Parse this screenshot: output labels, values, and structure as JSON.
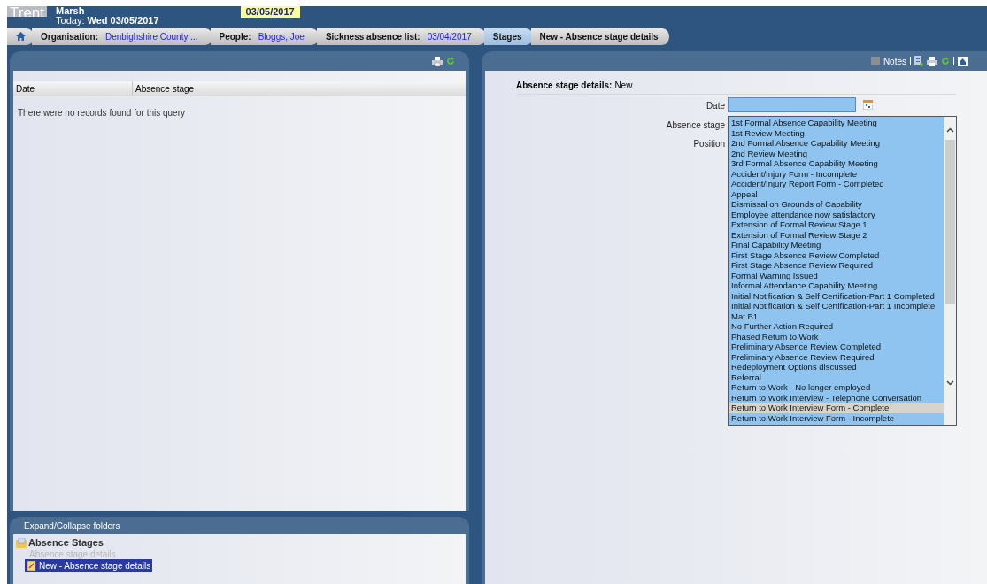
{
  "header": {
    "logo": "Trent",
    "user": "Marsh",
    "today_label": "Today:",
    "today_value": "Wed 03/05/2017",
    "date_badge": "03/05/2017"
  },
  "breadcrumbs": [
    {
      "kind": "home"
    },
    {
      "kind": "pair",
      "label": "Organisation:",
      "value": "Denbighshire County ..."
    },
    {
      "kind": "pair",
      "label": "People:",
      "value": "Bloggs, Joe"
    },
    {
      "kind": "pair",
      "label": "Sickness absence list:",
      "value": "03/04/2017"
    },
    {
      "kind": "plain",
      "label": "Stages",
      "selected": true
    },
    {
      "kind": "plain",
      "label": "New - Absence stage details",
      "selected": false
    }
  ],
  "left_panel": {
    "table": {
      "columns": [
        "Date",
        "Absence stage"
      ],
      "empty_message": "There were no records found for this query"
    }
  },
  "folders": {
    "title": "Expand/Collapse folders",
    "tree": [
      {
        "label": "Absence Stages",
        "children": [
          {
            "label": "Absence stage details",
            "disabled": true,
            "selected": false
          },
          {
            "label": "New - Absence stage details",
            "disabled": false,
            "selected": true
          }
        ]
      }
    ]
  },
  "right_panel": {
    "toolbar": {
      "notes": "Notes"
    },
    "heading_label": "Absence stage details:",
    "heading_value": "New",
    "form": {
      "date_label": "Date",
      "stage_label": "Absence stage",
      "position_label": "Position",
      "options": [
        {
          "label": "1st Formal Absence Capability Meeting",
          "selected": false
        },
        {
          "label": "1st Review Meeting",
          "selected": false
        },
        {
          "label": "2nd Formal Absence Capability Meeting",
          "selected": false
        },
        {
          "label": "2nd Review Meeting",
          "selected": false
        },
        {
          "label": "3rd Formal Absence Capability Meeting",
          "selected": false
        },
        {
          "label": "Accident/Injury Form - Incomplete",
          "selected": false
        },
        {
          "label": "Accident/Injury Report Form - Completed",
          "selected": false
        },
        {
          "label": "Appeal",
          "selected": false
        },
        {
          "label": "Dismissal on Grounds of Capability",
          "selected": false
        },
        {
          "label": "Employee attendance now satisfactory",
          "selected": false
        },
        {
          "label": "Extension of Formal Review Stage 1",
          "selected": false
        },
        {
          "label": "Extension of Formal Review Stage 2",
          "selected": false
        },
        {
          "label": "Final Capability Meeting",
          "selected": false
        },
        {
          "label": "First Stage Absence Review Completed",
          "selected": false
        },
        {
          "label": "First Stage Absence Review Required",
          "selected": false
        },
        {
          "label": "Formal Warning Issued",
          "selected": false
        },
        {
          "label": "Informal Attendance Capability Meeting",
          "selected": false
        },
        {
          "label": "Initial Notification & Self Certification-Part 1 Completed",
          "selected": false
        },
        {
          "label": "Initial Notification & Self Certification-Part 1 Incomplete",
          "selected": false
        },
        {
          "label": "Mat B1",
          "selected": false
        },
        {
          "label": "No Further Action Required",
          "selected": false
        },
        {
          "label": "Phased Return to Work",
          "selected": false
        },
        {
          "label": "Preliminary Absence Review Completed",
          "selected": false
        },
        {
          "label": "Preliminary Absence Review Required",
          "selected": false
        },
        {
          "label": "Redeployment Options discussed",
          "selected": false
        },
        {
          "label": "Referral",
          "selected": false
        },
        {
          "label": "Return to Work - No longer employed",
          "selected": false
        },
        {
          "label": "Return to Work Interview - Telephone Conversation",
          "selected": false
        },
        {
          "label": "Return to Work Interview Form - Complete",
          "selected": true
        },
        {
          "label": "Return to Work Interview Form - Incomplete",
          "selected": false
        }
      ]
    }
  }
}
